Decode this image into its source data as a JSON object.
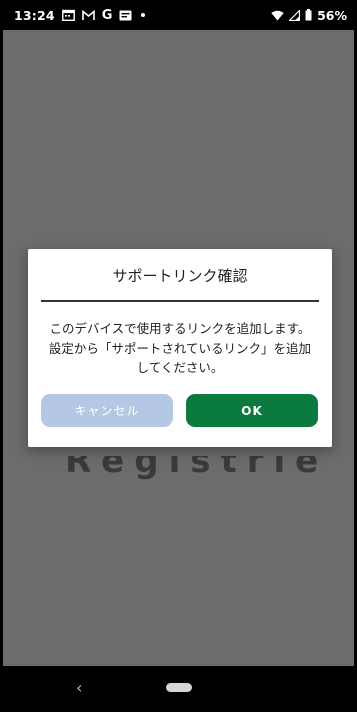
{
  "status_bar": {
    "time": "13:24",
    "notification_letter": "G",
    "battery_percent": "56%"
  },
  "background": {
    "partial_text": "Registrie"
  },
  "dialog": {
    "title": "サポートリンク確認",
    "message_line1": "このデバイスで使用するリンクを追加します。",
    "message_line2": "設定から「サポートされているリンク」を追加",
    "message_line3": "してください。",
    "cancel_label": "キャンセル",
    "ok_label": "OK"
  },
  "nav_bar": {
    "back_glyph": "‹"
  },
  "colors": {
    "ok_button": "#0b7a3f",
    "cancel_button_disabled": "#b4c8e6",
    "scrim": "#6c6c6c"
  },
  "icons": [
    "calendar-icon",
    "gmail-icon",
    "google-icon",
    "messages-icon",
    "notification-dot-icon",
    "wifi-icon",
    "signal-icon",
    "battery-icon"
  ]
}
